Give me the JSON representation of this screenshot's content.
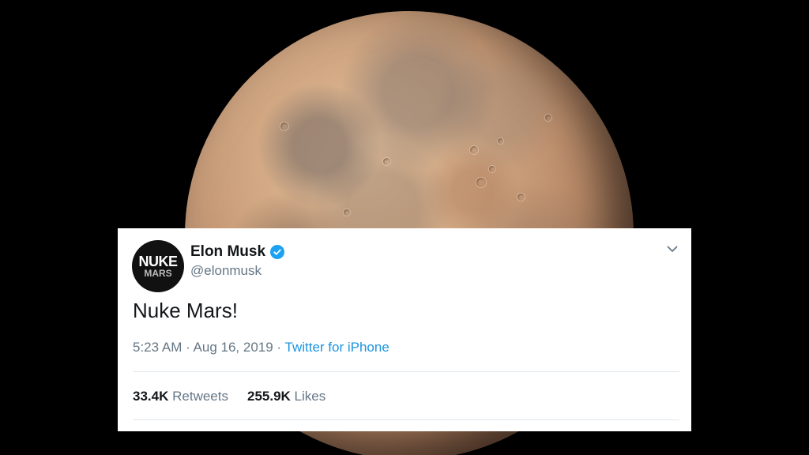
{
  "tweet": {
    "avatar": {
      "line1": "NUKE",
      "line2": "MARS"
    },
    "display_name": "Elon Musk",
    "verified_icon": "verified-badge-icon",
    "handle": "@elonmusk",
    "menu_icon": "chevron-down-icon",
    "text": "Nuke Mars!",
    "time": "5:23 AM",
    "separator1": " · ",
    "date": "Aug 16, 2019",
    "separator2": " · ",
    "source": "Twitter for iPhone",
    "retweets": {
      "count": "33.4K",
      "label": "Retweets"
    },
    "likes": {
      "count": "255.9K",
      "label": "Likes"
    }
  },
  "colors": {
    "background": "#000000",
    "card": "#ffffff",
    "link": "#1b95e0",
    "verified": "#1da1f2",
    "secondary_text": "#657786"
  }
}
